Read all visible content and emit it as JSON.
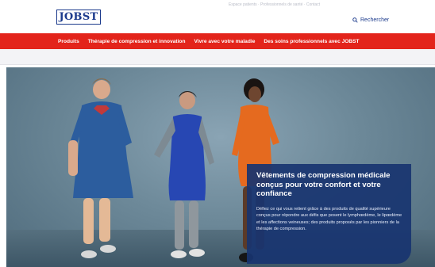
{
  "header": {
    "logo": "JOBST",
    "utility_text": "Espace patients · Professionnels de santé · Contact",
    "search_label": "Rechercher"
  },
  "nav": {
    "items": [
      "Produits",
      "Thérapie de compression et innovation",
      "Vivre avec votre maladie",
      "Des soins professionnels avec JOBST"
    ]
  },
  "hero": {
    "title": "Vêtements de compression médicale conçus pour votre confort et votre confiance",
    "text": "Défiez ce qui vous retient grâce à des produits de qualité supérieure conçus pour répondre aux défis que posent le lymphœdème, le lipœdème et les affections veineuses; des produits proposés par les pionniers de la thérapie de compression."
  },
  "colors": {
    "brand_blue": "#1b3a8c",
    "nav_red": "#e3241b",
    "panel_blue": "#183470"
  }
}
